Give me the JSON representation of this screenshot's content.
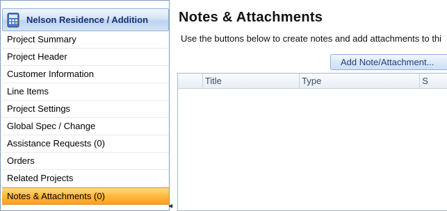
{
  "sidebar": {
    "title": "Nelson Residence / Addition",
    "items": [
      {
        "label": "Project Summary"
      },
      {
        "label": "Project Header"
      },
      {
        "label": "Customer Information"
      },
      {
        "label": "Line Items"
      },
      {
        "label": "Project Settings"
      },
      {
        "label": "Global Spec / Change"
      },
      {
        "label": "Assistance Requests (0)"
      },
      {
        "label": "Orders"
      },
      {
        "label": "Related Projects"
      },
      {
        "label": "Notes & Attachments (0)"
      }
    ],
    "active_index": 9
  },
  "main": {
    "title": "Notes & Attachments",
    "instructions": "Use the buttons below to create notes and add attachments to thi",
    "add_button_label": "Add Note/Attachment...",
    "grid": {
      "columns": [
        "",
        "Title",
        "Type",
        "S"
      ]
    }
  },
  "colors": {
    "active_item": "#ffb83d",
    "header_gradient": "#bcd3f0",
    "title_text": "#15307a"
  }
}
